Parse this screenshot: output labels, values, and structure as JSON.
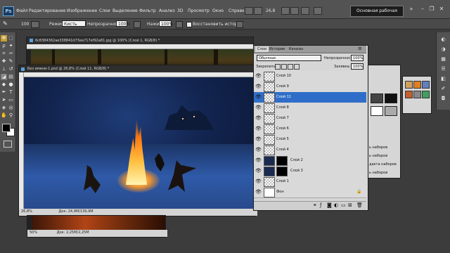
{
  "menubar": {
    "logo": "Ps",
    "items": [
      "Файл",
      "Редактирование",
      "Изображение",
      "Слои",
      "Выделение",
      "Фильтр",
      "Анализ",
      "3D",
      "Просмотр",
      "Окно",
      "Справка"
    ],
    "zoom": "26,8",
    "workspace": "Основная рабочая среда"
  },
  "options": {
    "mode_label": "Режим:",
    "mode_value": "Кисть",
    "opacity_label": "Непрозрачность:",
    "opacity_value": "100%",
    "pressure_label": "Нажим:",
    "pressure_value": "100%",
    "erase_history": "Восстановить историю",
    "brush_size": "100"
  },
  "doc_back": {
    "title": "6c8384362ae338841d73ea717ef92a81.jpg @ 100% (Слой 1, RGB/8) *"
  },
  "doc_main": {
    "title": "Без имени-1.psd @ 26,8% (Слой 11, RGB/8) *",
    "zoom": "26,8%",
    "doc_info": "Док: 24,9M/139,9M"
  },
  "doc_bottom": {
    "zoom": "50%",
    "doc_info": "Док: 2,25M/2,25M"
  },
  "layers_panel": {
    "tabs": [
      "Слои",
      "Истории",
      "Каналы"
    ],
    "blend_mode": "Обычные",
    "opacity_label": "Непрозрачность:",
    "opacity_value": "100%",
    "lock_label": "Закрепить:",
    "fill_label": "Заливка:",
    "fill_value": "100%",
    "layers": [
      {
        "name": "Слой 10",
        "selected": false,
        "mask": false
      },
      {
        "name": "Слой 9",
        "selected": false,
        "mask": false
      },
      {
        "name": "Слой 11",
        "selected": true,
        "mask": false
      },
      {
        "name": "Слой 8",
        "selected": false,
        "mask": false
      },
      {
        "name": "Слой 7",
        "selected": false,
        "mask": false
      },
      {
        "name": "Слой 6",
        "selected": false,
        "mask": false
      },
      {
        "name": "Слой 5",
        "selected": false,
        "mask": false
      },
      {
        "name": "Слой 4",
        "selected": false,
        "mask": false
      },
      {
        "name": "Слой 2",
        "selected": false,
        "mask": true
      },
      {
        "name": "Слой 3",
        "selected": false,
        "mask": true
      },
      {
        "name": "Слой 1",
        "selected": false,
        "mask": false
      },
      {
        "name": "Фон",
        "selected": false,
        "mask": false
      }
    ]
  },
  "right_panel": {
    "items": [
      "ь наборов",
      "ь наборов",
      "дакта наборов",
      "ь наборов"
    ]
  },
  "colors": {
    "foreground": "#000000",
    "background": "#ffffff",
    "selection": "#2f6ec8"
  }
}
